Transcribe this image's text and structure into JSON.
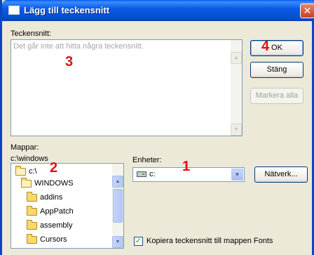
{
  "window": {
    "title": "Lägg till teckensnitt",
    "close_glyph": "✕"
  },
  "fonts": {
    "label": "Teckensnitt:",
    "empty_message": "Det går inte att hitta några teckensnitt."
  },
  "buttons": {
    "ok": "OK",
    "close": "Stäng",
    "select_all": "Markera alla",
    "network": "Nätverk..."
  },
  "folders": {
    "label": "Mappar:",
    "current_path": "c:\\windows",
    "items": [
      "c:\\",
      "WINDOWS",
      "addins",
      "AppPatch",
      "assembly",
      "Cursors"
    ]
  },
  "drives": {
    "label": "Enheter:",
    "selected": "c:"
  },
  "copy_option": {
    "label": "Kopiera teckensnitt till mappen Fonts",
    "checked": true
  },
  "annotations": {
    "m1": "1",
    "m2": "2",
    "m3": "3",
    "m4": "4"
  },
  "colors": {
    "title_blue": "#0a5be6",
    "marker_red": "#e01010",
    "dialog_bg": "#ece9d8"
  }
}
